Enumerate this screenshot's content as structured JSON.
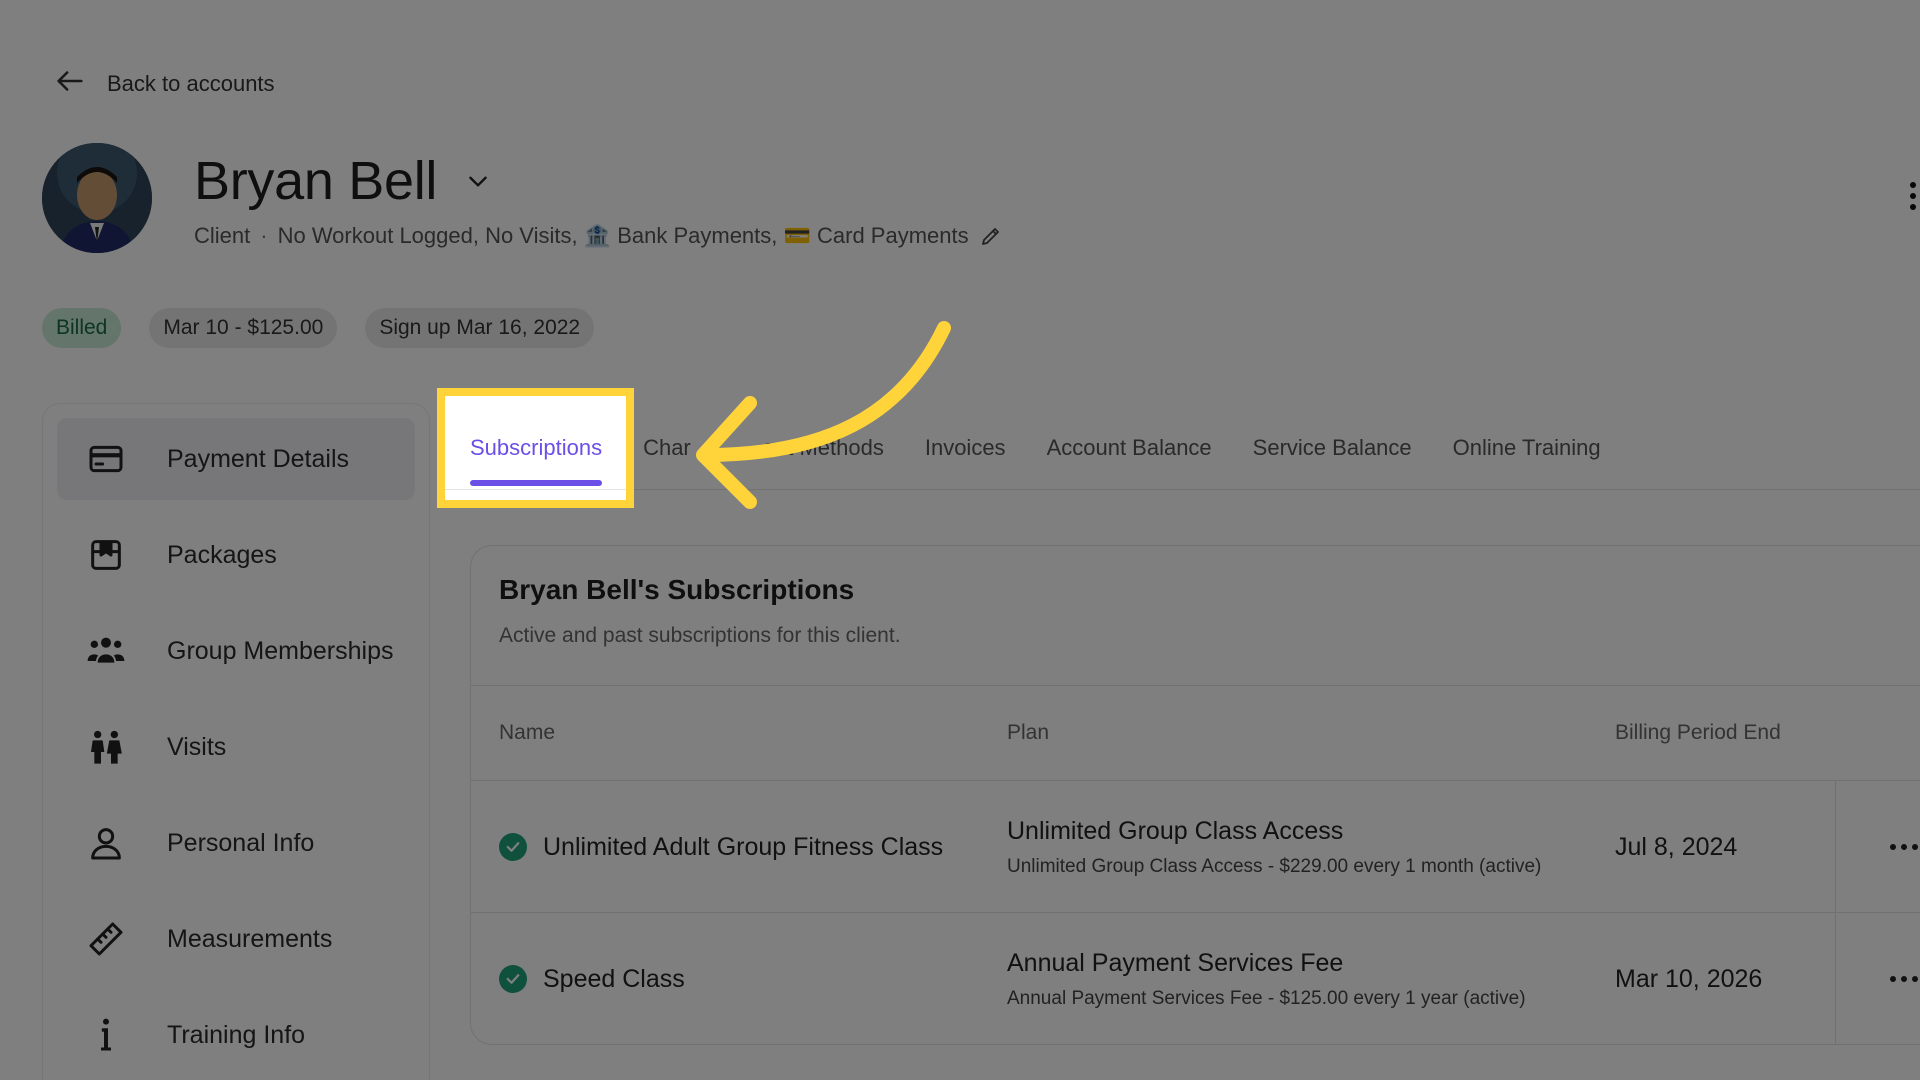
{
  "back": {
    "label": "Back to accounts"
  },
  "client": {
    "name": "Bryan Bell",
    "role": "Client",
    "separator": "·",
    "tags": "No Workout Logged, No Visits, 🏦 Bank Payments, 💳 Card Payments"
  },
  "badges": {
    "status": "Billed",
    "billing": "Mar 10 - $125.00",
    "signup": "Sign up Mar 16, 2022"
  },
  "sidebar": {
    "items": [
      {
        "label": "Payment Details",
        "icon": "credit-card-icon"
      },
      {
        "label": "Packages",
        "icon": "package-icon"
      },
      {
        "label": "Group Memberships",
        "icon": "group-icon"
      },
      {
        "label": "Visits",
        "icon": "visits-icon"
      },
      {
        "label": "Personal Info",
        "icon": "person-icon"
      },
      {
        "label": "Measurements",
        "icon": "ruler-icon"
      },
      {
        "label": "Training Info",
        "icon": "info-icon"
      }
    ]
  },
  "tabs": [
    {
      "label": "Subscriptions"
    },
    {
      "label": "Char"
    },
    {
      "label": "ent Methods"
    },
    {
      "label": "Invoices"
    },
    {
      "label": "Account Balance"
    },
    {
      "label": "Service Balance"
    },
    {
      "label": "Online Training"
    }
  ],
  "subscriptions": {
    "title": "Bryan Bell's Subscriptions",
    "subtitle": "Active and past subscriptions for this client.",
    "columns": {
      "name": "Name",
      "plan": "Plan",
      "end": "Billing Period End"
    },
    "rows": [
      {
        "name": "Unlimited Adult Group Fitness Class",
        "plan_title": "Unlimited Group Class Access",
        "plan_desc": "Unlimited Group Class Access - $229.00 every 1 month (active)",
        "end": "Jul 8, 2024"
      },
      {
        "name": "Speed Class",
        "plan_title": "Annual Payment Services Fee",
        "plan_desc": "Annual Payment Services Fee - $125.00 every 1 year (active)",
        "end": "Mar 10, 2026"
      }
    ]
  },
  "colors": {
    "accent": "#6b4fe6",
    "highlight": "#ffd43b",
    "success": "#1ea37a",
    "overlay": "rgba(0,0,0,0.5)"
  }
}
